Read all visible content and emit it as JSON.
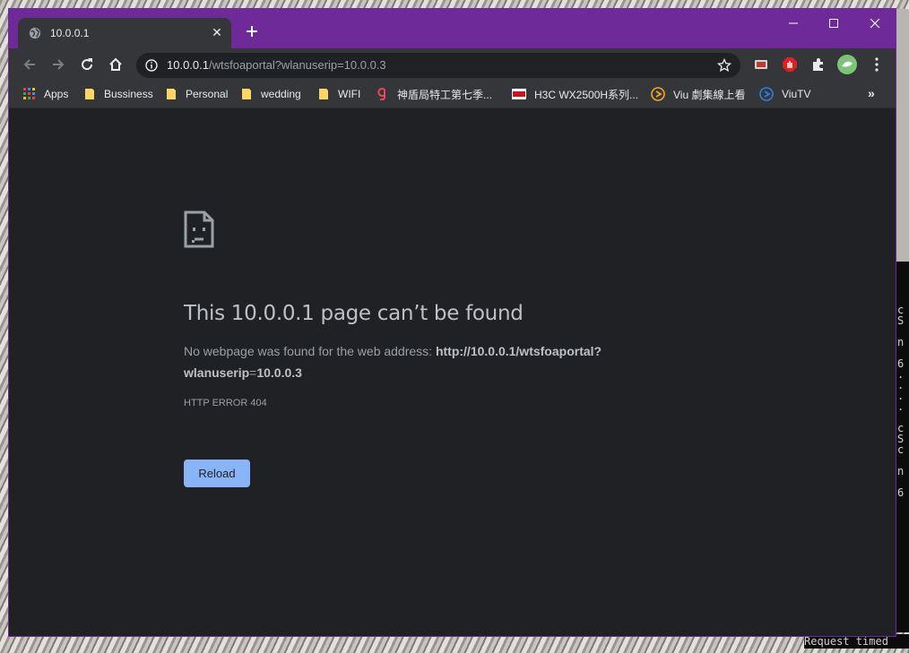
{
  "tab": {
    "title": "10.0.0.1",
    "close": "✕"
  },
  "address_bar": {
    "host": "10.0.0.1",
    "path": "/wtsfoaportal?wlanuserip=10.0.0.3"
  },
  "bookmarks": [
    {
      "label": "Apps",
      "icon": "apps-grid-icon"
    },
    {
      "label": "Bussiness",
      "icon": "folder-icon"
    },
    {
      "label": "Personal",
      "icon": "folder-icon"
    },
    {
      "label": "wedding",
      "icon": "folder-icon"
    },
    {
      "label": "WIFI",
      "icon": "folder-icon"
    },
    {
      "label": "神盾局特工第七季...",
      "icon": "site-favicon-icon"
    },
    {
      "label": "H3C WX2500H系列...",
      "icon": "h3c-favicon-icon"
    },
    {
      "label": "Viu 劇集線上看",
      "icon": "viu-icon"
    },
    {
      "label": "ViuTV",
      "icon": "viutv-icon"
    }
  ],
  "bookmarks_more": "»",
  "error": {
    "title": "This 10.0.0.1 page can’t be found",
    "desc_prefix": "No webpage was found for the web address: ",
    "desc_url_line1": "http://10.0.0.1/wtsfoaportal?",
    "desc_url_line2a": "wlanuserip",
    "desc_url_eq": "=",
    "desc_url_line2b": "10.0.0.3",
    "code": "HTTP ERROR 404",
    "reload_label": "Reload"
  },
  "background_console": {
    "glyphs": [
      "c",
      "S",
      "",
      "n",
      "",
      "6",
      ".",
      ".",
      ".",
      ".",
      "",
      "c",
      "S",
      "c",
      "",
      "n",
      "",
      "6"
    ],
    "bottom_text": "Request timed"
  },
  "colors": {
    "titlebar": "#6f2a99",
    "toolbar": "#35363a",
    "page_bg": "#202124",
    "reload_button": "#8ab4f8"
  }
}
